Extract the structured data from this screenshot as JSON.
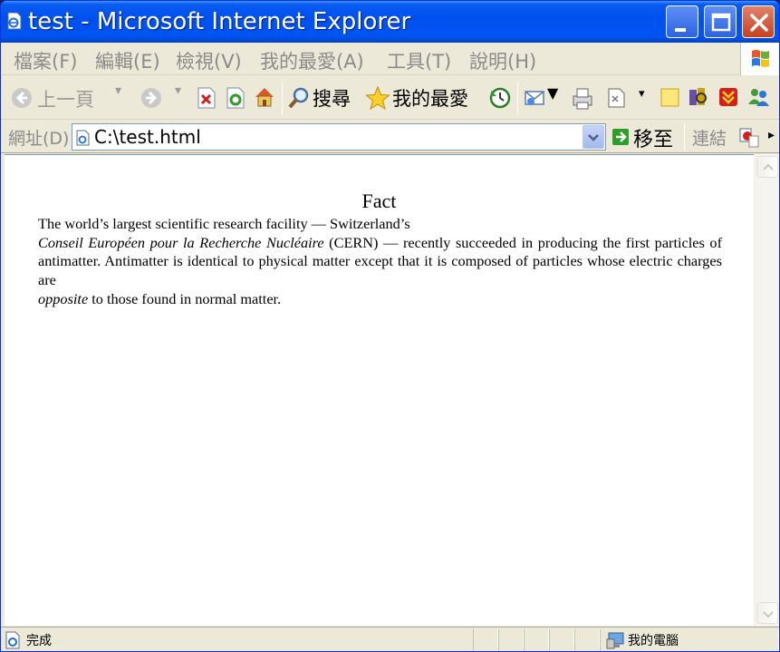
{
  "window": {
    "title": "test - Microsoft Internet Explorer"
  },
  "menu": {
    "items": [
      "檔案(F)",
      "編輯(E)",
      "檢視(V)",
      "我的最愛(A)",
      "工具(T)",
      "說明(H)"
    ]
  },
  "toolbar": {
    "back_label": "上一頁",
    "search_label": "搜尋",
    "favorites_label": "我的最愛"
  },
  "address": {
    "label": "網址(D)",
    "value": "C:\\test.html",
    "go_label": "移至",
    "links_label": "連結"
  },
  "page": {
    "heading": "Fact",
    "line1": "The world’s largest scientific research facility — Switzerland’s",
    "org_name": "Conseil Européen pour la Recherche Nucléaire",
    "text_after_org": " (CERN) — recently succeeded in producing the first particles of antimatter. Antimatter is identical to physical matter except that it is composed of particles whose electric charges are",
    "emph_word": "opposite",
    "text_end": " to those found in normal matter."
  },
  "status": {
    "text": "完成",
    "zone": "我的電腦"
  },
  "colors": {
    "titlebar": "#0055f2",
    "chrome": "#ece9d8",
    "close_button": "#c7401f"
  }
}
